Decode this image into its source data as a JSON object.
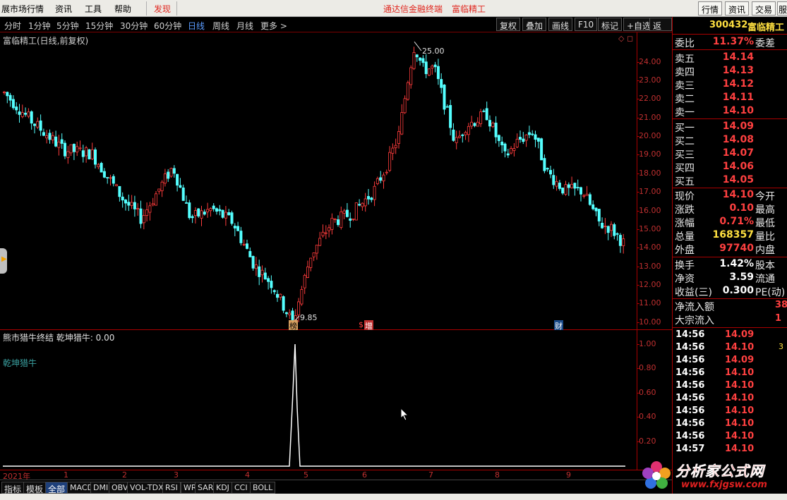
{
  "menubar": {
    "items": [
      "展市场行情",
      "资讯",
      "工具",
      "帮助"
    ],
    "highlight": "发现",
    "center_left": "通达信金融终端",
    "center_right": "富临精工",
    "right_buttons": [
      "行情",
      "资讯",
      "交易",
      "服"
    ]
  },
  "toolbar": {
    "periods": [
      "分时",
      "1分钟",
      "5分钟",
      "15分钟",
      "30分钟",
      "60分钟",
      "日线",
      "周线",
      "月线",
      "更多 >"
    ],
    "active_period": "日线",
    "buttons": [
      "复权",
      "叠加",
      "画线",
      "F10",
      "标记",
      "+自选",
      "返回"
    ]
  },
  "main_chart": {
    "title": "富临精工(日线,前复权)",
    "max_label": "25.00",
    "min_label": "9.85",
    "y_ticks": [
      "24.00",
      "23.00",
      "22.00",
      "21.00",
      "20.00",
      "19.00",
      "18.00",
      "17.00",
      "16.00",
      "15.00",
      "14.00",
      "13.00",
      "12.00",
      "11.00",
      "10.00"
    ],
    "markers": [
      "榜",
      "增",
      "财"
    ]
  },
  "sub_chart": {
    "title": "熊市猎牛终结 乾坤猎牛: 0.00",
    "legend": "乾坤猎牛",
    "y_ticks": [
      "1.00",
      "0.80",
      "0.60",
      "0.40",
      "0.20"
    ]
  },
  "chart_data": {
    "type": "candlestick",
    "title": "富临精工(日线,前复权)",
    "x_axis_labels": [
      "2021年",
      "1",
      "2",
      "3",
      "4",
      "5",
      "6",
      "7",
      "8",
      "9"
    ],
    "ylim": [
      9.5,
      25.5
    ],
    "max_point": 25.0,
    "min_point": 9.85,
    "last_price": 14.1,
    "indicator": {
      "name": "乾坤猎牛",
      "ylim": [
        0,
        1.0
      ],
      "spike_value": 1.0,
      "spike_position_label": "5"
    }
  },
  "date_axis": [
    "2021年",
    "1",
    "2",
    "3",
    "4",
    "5",
    "6",
    "7",
    "8",
    "9"
  ],
  "bottom_tabs": [
    "指标",
    "模板",
    "全部",
    "MACD",
    "DMI",
    "OBV",
    "VOL-TDX",
    "RSI",
    "WR",
    "SAR",
    "KDJ",
    "CCI",
    "BOLL"
  ],
  "active_tab": "全部",
  "quote": {
    "code": "300432",
    "name": "富临精工",
    "weibi_label": "委比",
    "weibi_value": "11.37%",
    "weicha_label": "委差",
    "asks": [
      {
        "label": "卖五",
        "price": "14.14"
      },
      {
        "label": "卖四",
        "price": "14.13"
      },
      {
        "label": "卖三",
        "price": "14.12"
      },
      {
        "label": "卖二",
        "price": "14.11"
      },
      {
        "label": "卖一",
        "price": "14.10"
      }
    ],
    "bids": [
      {
        "label": "买一",
        "price": "14.09"
      },
      {
        "label": "买二",
        "price": "14.08"
      },
      {
        "label": "买三",
        "price": "14.07"
      },
      {
        "label": "买四",
        "price": "14.06"
      },
      {
        "label": "买五",
        "price": "14.05"
      }
    ],
    "stats": [
      {
        "label": "现价",
        "value": "14.10",
        "right": "今开"
      },
      {
        "label": "涨跌",
        "value": "0.10",
        "right": "最高"
      },
      {
        "label": "涨幅",
        "value": "0.71%",
        "right": "最低"
      },
      {
        "label": "总量",
        "value": "168357",
        "right": "量比"
      },
      {
        "label": "外盘",
        "value": "97740",
        "right": "内盘"
      }
    ],
    "stats2": [
      {
        "label": "换手",
        "value": "1.42%",
        "right": "股本"
      },
      {
        "label": "净资",
        "value": "3.59",
        "right": "流通"
      },
      {
        "label": "收益(三)",
        "value": "0.300",
        "right": "PE(动)"
      }
    ],
    "flows": [
      {
        "label": "净流入额",
        "value": "38"
      },
      {
        "label": "大宗流入",
        "value": "1"
      }
    ],
    "ticks": [
      {
        "time": "14:56",
        "price": "14.09",
        "extra": ""
      },
      {
        "time": "14:56",
        "price": "14.10",
        "extra": "3"
      },
      {
        "time": "14:56",
        "price": "14.09",
        "extra": ""
      },
      {
        "time": "14:56",
        "price": "14.10",
        "extra": ""
      },
      {
        "time": "14:56",
        "price": "14.10",
        "extra": ""
      },
      {
        "time": "14:56",
        "price": "14.10",
        "extra": ""
      },
      {
        "time": "14:56",
        "price": "14.10",
        "extra": ""
      },
      {
        "time": "14:56",
        "price": "14.10",
        "extra": ""
      },
      {
        "time": "14:56",
        "price": "14.10",
        "extra": ""
      },
      {
        "time": "14:57",
        "price": "14.10",
        "extra": ""
      }
    ]
  },
  "watermark": {
    "text": "分析家公式网",
    "url": "www.fxjgsw.com"
  }
}
